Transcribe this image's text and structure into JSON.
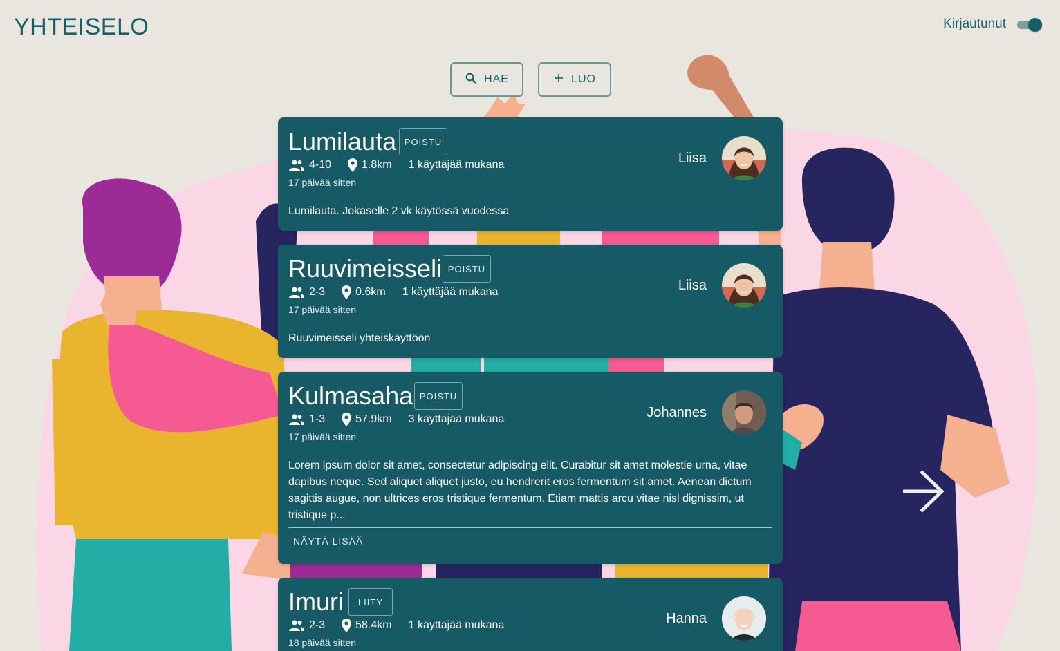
{
  "app": {
    "title": "YHTEISELO",
    "login_label": "Kirjautunut",
    "login_on": true
  },
  "actions": {
    "search_label": "HAE",
    "create_label": "LUO"
  },
  "colors": {
    "primary": "#155a64",
    "background": "#e9e6e0",
    "accent_pink": "#f55b92",
    "accent_yellow": "#e9b52f",
    "accent_navy": "#272560",
    "accent_purple": "#9c2b96",
    "accent_teal": "#22ada5"
  },
  "cards": [
    {
      "title": "Lumilauta",
      "button": "POISTU",
      "size": "4-10",
      "distance": "1.8km",
      "members": "1 käyttäjää mukana",
      "age": "17 päivää sitten",
      "description": "Lumilauta. Jokaselle 2 vk käytössä vuodessa",
      "owner": "Liisa",
      "avatar": "woman-brown-hair-avatar"
    },
    {
      "title": "Ruuvimeisseli",
      "button": "POISTU",
      "size": "2-3",
      "distance": "0.6km",
      "members": "1 käyttäjää mukana",
      "age": "17 päivää sitten",
      "description": "Ruuvimeisseli yhteiskäyttöön",
      "owner": "Liisa",
      "avatar": "woman-brown-hair-avatar"
    },
    {
      "title": "Kulmasaha",
      "button": "POISTU",
      "size": "1-3",
      "distance": "57.9km",
      "members": "3 käyttäjää mukana",
      "age": "17 päivää sitten",
      "description": "Lorem ipsum dolor sit amet, consectetur adipiscing elit. Curabitur sit amet molestie urna, vitae dapibus neque. Sed aliquet aliquet justo, eu hendrerit eros fermentum sit amet. Aenean dictum sagittis augue, non ultrices eros tristique fermentum. Etiam mattis arcu vitae nisl dignissim, ut tristique p...",
      "more_label": "NÄYTÄ LISÄÄ",
      "owner": "Johannes",
      "avatar": "man-short-hair-avatar"
    },
    {
      "title": "Imuri",
      "button": "LIITY",
      "size": "2-3",
      "distance": "58.4km",
      "members": "1 käyttäjää mukana",
      "age": "18 päivää sitten",
      "owner": "Hanna",
      "avatar": "woman-blonde-hair-avatar"
    }
  ],
  "icons": {
    "group": "group-icon",
    "location": "location-pin-icon",
    "search": "search-icon",
    "add": "plus-icon",
    "next": "arrow-right-icon"
  }
}
